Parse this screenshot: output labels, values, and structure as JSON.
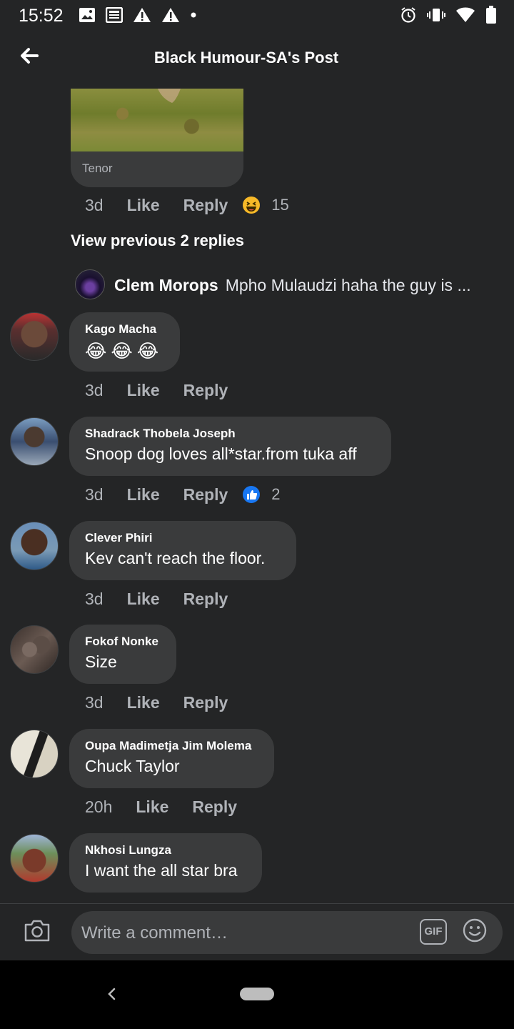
{
  "status_bar": {
    "time": "15:52",
    "left_icons": [
      "gallery-icon",
      "news-icon",
      "alert-icon",
      "alert-icon",
      "dot-icon"
    ],
    "right_icons": [
      "alarm-icon",
      "vibrate-icon",
      "wifi-icon",
      "battery-icon"
    ]
  },
  "header": {
    "title": "Black Humour-SA's Post",
    "back_icon": "back-arrow-icon"
  },
  "gif_preview": {
    "source": "Tenor",
    "time": "3d",
    "like_label": "Like",
    "reply_label": "Reply",
    "reaction_icon": "haha-reaction-icon",
    "reaction_count": "15"
  },
  "view_previous": "View previous 2 replies",
  "latest_reply": {
    "name": "Clem Morops",
    "text": "Mpho Mulaudzi haha the guy is ..."
  },
  "comments": [
    {
      "name": "Kago Macha",
      "text": "😂😂😂",
      "time": "3d",
      "like": "Like",
      "reply": "Reply",
      "reaction_count": ""
    },
    {
      "name": "Shadrack Thobela Joseph",
      "text": "Snoop dog loves all*star.from tuka aff",
      "time": "3d",
      "like": "Like",
      "reply": "Reply",
      "reaction_count": "2",
      "reaction_icon": "like-reaction-icon"
    },
    {
      "name": "Clever Phiri",
      "text": "Kev can't reach the floor.",
      "time": "3d",
      "like": "Like",
      "reply": "Reply"
    },
    {
      "name": "Fokof Nonke",
      "text": "Size",
      "time": "3d",
      "like": "Like",
      "reply": "Reply"
    },
    {
      "name": "Oupa Madimetja Jim Molema",
      "text": "Chuck Taylor",
      "time": "20h",
      "like": "Like",
      "reply": "Reply"
    },
    {
      "name": "Nkhosi Lungza",
      "text": "I want the all star bra"
    }
  ],
  "composer": {
    "placeholder": "Write a comment…",
    "gif_label": "GIF",
    "camera_icon": "camera-icon",
    "emoji_icon": "emoji-icon"
  },
  "colors": {
    "background": "#242526",
    "bubble": "#3a3b3c",
    "secondary_text": "#b0b3b8",
    "like_blue": "#1877f2"
  }
}
